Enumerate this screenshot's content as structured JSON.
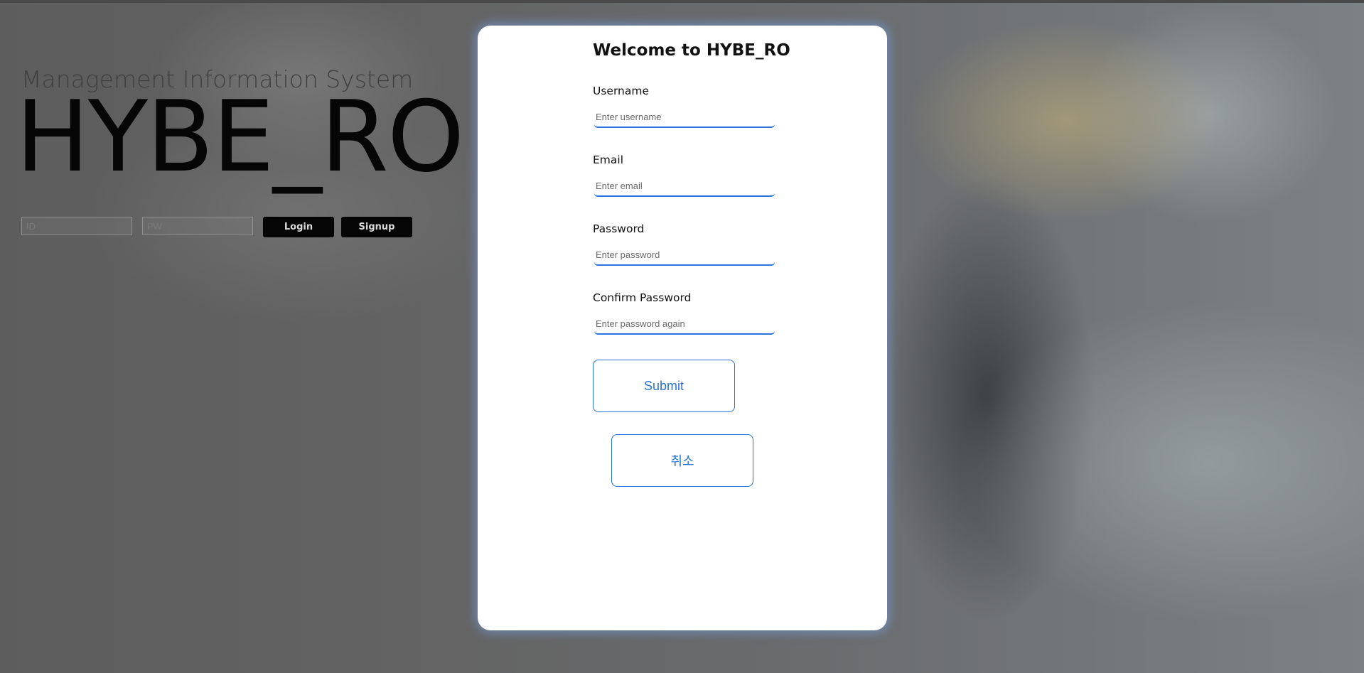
{
  "background": {
    "subtitle": "Management Information System",
    "title": "HYBE_RO",
    "login": {
      "id_placeholder": "ID",
      "pw_placeholder": "PW",
      "login_label": "Login",
      "signup_label": "Signup"
    }
  },
  "signup_modal": {
    "title": "Welcome to HYBE_RO",
    "fields": [
      {
        "label": "Username",
        "placeholder": "Enter username"
      },
      {
        "label": "Email",
        "placeholder": "Enter email"
      },
      {
        "label": "Password",
        "placeholder": "Enter password"
      },
      {
        "label": "Confirm Password",
        "placeholder": "Enter password again"
      }
    ],
    "submit_label": "Submit",
    "cancel_label": "취소"
  },
  "colors": {
    "accent": "#2a73e0",
    "modal_background": "#ffffff",
    "button_dark": "#050505"
  }
}
